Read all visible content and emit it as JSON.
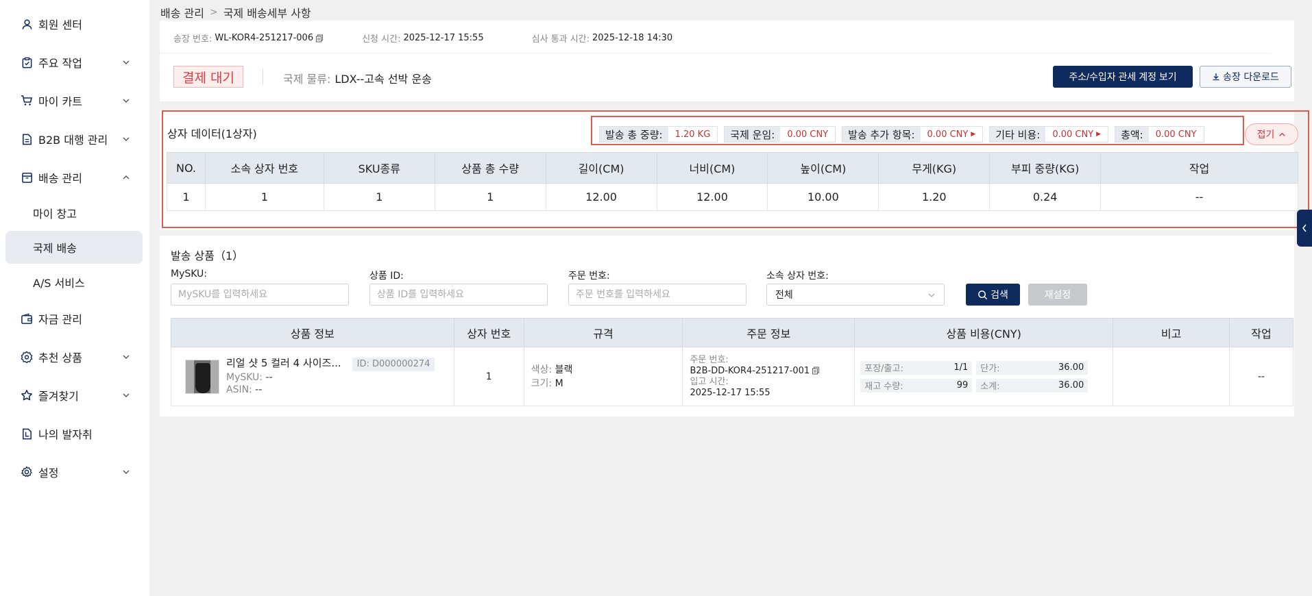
{
  "sidebar": {
    "items": [
      {
        "label": "회원 센터",
        "icon": "user-icon",
        "has_chevron": false
      },
      {
        "label": "주요 작업",
        "icon": "clipboard-icon",
        "has_chevron": true
      },
      {
        "label": "마이 카트",
        "icon": "cart-icon",
        "has_chevron": true
      },
      {
        "label": "B2B 대행 관리",
        "icon": "document-icon",
        "has_chevron": true
      },
      {
        "label": "배송 관리",
        "icon": "box-icon",
        "has_chevron": true,
        "expanded": true
      },
      {
        "label": "자금 관리",
        "icon": "wallet-icon",
        "has_chevron": false
      },
      {
        "label": "추천 상품",
        "icon": "badge-icon",
        "has_chevron": true
      },
      {
        "label": "즐겨찾기",
        "icon": "star-icon",
        "has_chevron": true
      },
      {
        "label": "나의 발자취",
        "icon": "footprint-icon",
        "has_chevron": false
      },
      {
        "label": "설정",
        "icon": "gear-icon",
        "has_chevron": true
      }
    ],
    "sub_items": [
      {
        "label": "마이 창고",
        "active": false
      },
      {
        "label": "국제 배송",
        "active": true
      },
      {
        "label": "A/S 서비스",
        "active": false
      }
    ]
  },
  "breadcrumb": {
    "parent": "배송 관리",
    "current": "국제 배송세부 사항"
  },
  "header": {
    "invoice_label": "송장 번호:",
    "invoice_value": "WL-KOR4-251217-006",
    "apply_label": "신청 시간:",
    "apply_value": "2025-12-17 15:55",
    "review_label": "심사 통과 시간:",
    "review_value": "2025-12-18 14:30",
    "status": "결제 대기",
    "logistics_label": "국제 물류:",
    "logistics_value": "LDX--고속 선박 운송",
    "btn_view_account": "주소/수입자 관세 계정 보기",
    "btn_download": "송장 다운로드"
  },
  "box_data": {
    "title": "상자 데이터(1상자)",
    "pills": [
      {
        "label": "발송 총 중량:",
        "value": "1.20 KG",
        "has_arrow": false
      },
      {
        "label": "국제 운임:",
        "value": "0.00 CNY",
        "has_arrow": false
      },
      {
        "label": "발송 추가 항목:",
        "value": "0.00 CNY",
        "has_arrow": true
      },
      {
        "label": "기타 비용:",
        "value": "0.00 CNY",
        "has_arrow": true
      },
      {
        "label": "총액:",
        "value": "0.00 CNY",
        "has_arrow": false
      }
    ],
    "fold_label": "접기",
    "columns": [
      "NO.",
      "소속 상자 번호",
      "SKU종류",
      "상품 총 수량",
      "길이(CM)",
      "너비(CM)",
      "높이(CM)",
      "무게(KG)",
      "부피 중량(KG)",
      "작업"
    ],
    "rows": [
      [
        "1",
        "1",
        "1",
        "1",
        "12.00",
        "12.00",
        "10.00",
        "1.20",
        "0.24",
        "--"
      ]
    ]
  },
  "products": {
    "title": "발송 상품（1）",
    "filters": {
      "mysku_label": "MySKU:",
      "mysku_placeholder": "MySKU를 입력하세요",
      "pid_label": "상품 ID:",
      "pid_placeholder": "상품 ID를 입력하세요",
      "order_label": "주문 번호:",
      "order_placeholder": "주문 번호를 입력하세요",
      "box_label": "소속 상자 번호:",
      "box_value": "전체",
      "search_label": "검색",
      "reset_label": "재설정"
    },
    "columns": [
      "상품 정보",
      "상자 번호",
      "규격",
      "주문 정보",
      "상품 비용(CNY)",
      "비고",
      "작업"
    ],
    "rows": [
      {
        "name": "리얼 샷 5 컬러 4 사이즈...",
        "id_badge": "ID: D000000274",
        "mysku_label": "MySKU:",
        "mysku_value": "--",
        "asin_label": "ASIN:",
        "asin_value": "--",
        "box_no": "1",
        "color_label": "색상:",
        "color_value": "블랙",
        "size_label": "크기:",
        "size_value": "M",
        "order_no_label": "주문 번호:",
        "order_no_value": "B2B-DD-KOR4-251217-001",
        "stock_in_label": "입고 시간:",
        "stock_in_value": "2025-12-17 15:55",
        "pack_label": "포장/출고:",
        "pack_value": "1/1",
        "unit_label": "단가:",
        "unit_value": "36.00",
        "stock_label": "재고 수량:",
        "stock_value": "99",
        "subtotal_label": "소계:",
        "subtotal_value": "36.00",
        "remark": "",
        "action": "--"
      }
    ]
  }
}
